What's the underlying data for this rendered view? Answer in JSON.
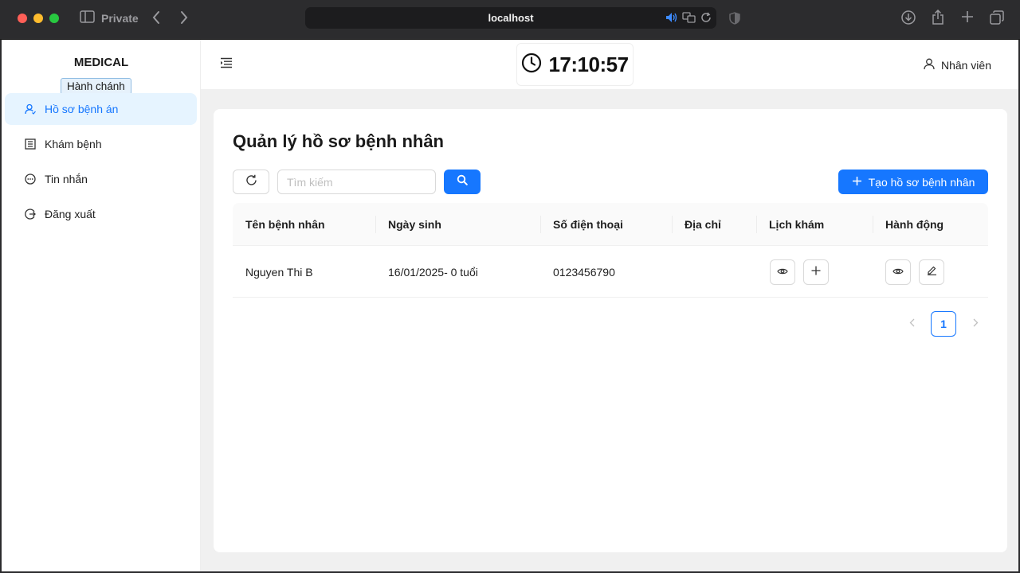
{
  "browser": {
    "mode_label": "Private",
    "url": "localhost"
  },
  "sidebar": {
    "brand": "MEDICAL",
    "role": "Hành chánh",
    "items": [
      {
        "label": "Hồ sơ bệnh án",
        "icon": "user-icon",
        "active": true
      },
      {
        "label": "Khám bệnh",
        "icon": "building-icon",
        "active": false
      },
      {
        "label": "Tin nhắn",
        "icon": "message-icon",
        "active": false
      },
      {
        "label": "Đăng xuất",
        "icon": "logout-icon",
        "active": false
      }
    ]
  },
  "header": {
    "clock": "17:10:57",
    "user_label": "Nhân viên"
  },
  "main": {
    "title": "Quản lý hồ sơ bệnh nhân",
    "search_placeholder": "Tìm kiếm",
    "create_label": "Tạo hồ sơ bệnh nhân",
    "columns": [
      "Tên bệnh nhân",
      "Ngày sinh",
      "Số điện thoại",
      "Địa chỉ",
      "Lịch khám",
      "Hành động"
    ],
    "rows": [
      {
        "name": "Nguyen Thi B",
        "dob": "16/01/2025- 0 tuổi",
        "phone": "0123456790",
        "address": ""
      }
    ],
    "pagination": {
      "current": "1"
    }
  },
  "colors": {
    "accent": "#1677ff",
    "active_bg": "#e6f4ff"
  }
}
